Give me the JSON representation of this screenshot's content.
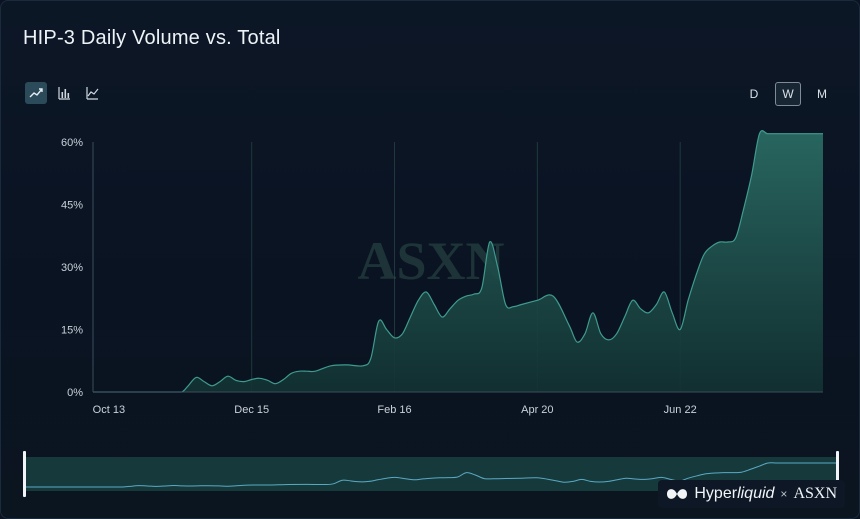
{
  "title": "HIP-3 Daily Volume vs. Total",
  "chart_types": [
    {
      "icon": "trend-line-icon",
      "active": true
    },
    {
      "icon": "bar-chart-icon",
      "active": false
    },
    {
      "icon": "line-chart-icon",
      "active": false
    }
  ],
  "periods": [
    {
      "label": "D",
      "active": false
    },
    {
      "label": "W",
      "active": true
    },
    {
      "label": "M",
      "active": false
    }
  ],
  "watermark": "ASXN",
  "branding": {
    "hyper": "Hyper",
    "liquid": "liquid",
    "x": "×",
    "asxn": "ASXN"
  },
  "colors": {
    "accent": "#2f7f78",
    "line": "#3f9b8f",
    "fill": "#1d4a47",
    "grid": "#1f3a3c"
  },
  "chart_data": {
    "type": "area",
    "title": "HIP-3 Daily Volume vs. Total",
    "xlabel": "",
    "ylabel": "",
    "x_ticks": [
      "Oct 13",
      "Dec 15",
      "Feb 16",
      "Apr 20",
      "Jun 22"
    ],
    "y_ticks": [
      "0%",
      "15%",
      "30%",
      "45%",
      "60%"
    ],
    "ylim": [
      0,
      60
    ],
    "x_range_weeks": [
      0,
      46
    ],
    "grid": "vertical",
    "series": [
      {
        "x": [
          0,
          1,
          2,
          3,
          4,
          5,
          5.6,
          6,
          6.5,
          7,
          7.5,
          8,
          8.5,
          9,
          9.5,
          10,
          10.5,
          11,
          11.5,
          12,
          12.5,
          13,
          13.5,
          14,
          15,
          16,
          17,
          17.5,
          18,
          18.5,
          19,
          19.5,
          20,
          20.5,
          21,
          21.5,
          22,
          22.5,
          23,
          23.5,
          24,
          24.5,
          25,
          25.5,
          26,
          26.5,
          27,
          28,
          29,
          30,
          30.5,
          31,
          31.5,
          32,
          32.5,
          33,
          33.5,
          34,
          34.5,
          35,
          35.5,
          36,
          36.5,
          37,
          37.5,
          38,
          38.5,
          39,
          39.5,
          40,
          40.5,
          41,
          41.5,
          42,
          42.5,
          43,
          43.5,
          44,
          44.5,
          45,
          45.5,
          46
        ],
        "y": [
          0,
          0,
          0,
          0,
          0,
          0,
          0,
          1.5,
          3.5,
          2.5,
          1.5,
          2.5,
          3.8,
          2.8,
          2.5,
          3,
          3.3,
          2.8,
          2,
          3,
          4.5,
          5,
          5,
          5,
          6.3,
          6.5,
          6.3,
          8,
          17,
          15,
          13,
          14,
          18,
          22,
          24,
          21,
          18,
          20,
          22,
          23,
          23.5,
          25,
          36,
          30,
          21,
          20.5,
          21,
          22,
          23,
          16,
          12,
          14,
          19,
          14,
          12.5,
          14,
          18,
          22,
          20,
          19,
          21,
          24,
          19,
          15,
          22,
          28,
          33,
          35,
          36,
          36,
          37,
          44,
          52,
          62,
          62,
          62,
          62,
          62,
          62,
          62,
          62,
          62
        ]
      }
    ]
  }
}
